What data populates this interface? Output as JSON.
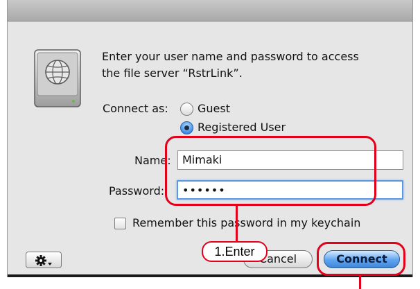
{
  "dialog": {
    "prompt_line1": "Enter your user name and password to access",
    "prompt_line2": "the file server “RstrLink”.",
    "connect_as_label": "Connect as:",
    "radio_options": [
      {
        "label": "Guest",
        "selected": false
      },
      {
        "label": "Registered User",
        "selected": true
      }
    ],
    "name_label": "Name:",
    "name_value": "Mimaki",
    "password_label": "Password:",
    "password_value": "••••••",
    "remember_label": "Remember this password in my keychain",
    "remember_checked": false,
    "gear_icon": "gear-icon",
    "cancel_label": "Cancel",
    "connect_label": "Connect",
    "icon": "network-drive-icon"
  },
  "annotation": {
    "step_label": "1.Enter",
    "color": "#e2001a"
  }
}
